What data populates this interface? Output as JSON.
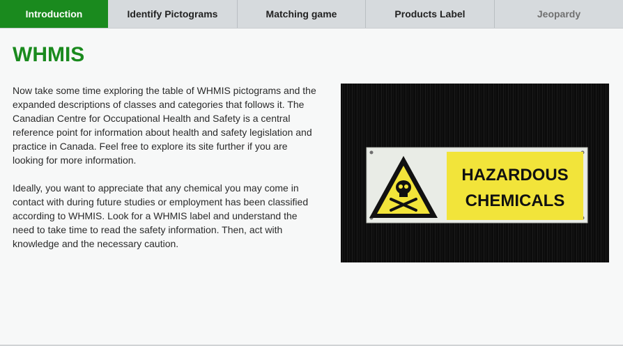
{
  "tabs": [
    {
      "label": "Introduction",
      "active": true
    },
    {
      "label": "Identify Pictograms"
    },
    {
      "label": "Matching game"
    },
    {
      "label": "Products Label"
    },
    {
      "label": "Jeopardy"
    }
  ],
  "page": {
    "title": "WHMIS",
    "paragraphs": [
      "Now take some time exploring the table of WHMIS pictograms and the expanded descriptions of classes and categories that follows it. The Canadian Centre for Occupational Health and Safety is a central reference point for information about health and safety legislation and practice in Canada. Feel free to explore its site further if you are looking for more information.",
      "Ideally, you want to appreciate that any chemical you may come in contact with during future studies or employment has been classified according to WHMIS. Look for a WHMIS label and understand the need to take time to read the safety information. Then, act with knowledge and the necessary caution."
    ]
  },
  "image": {
    "sign_line1": "HAZARDOUS",
    "sign_line2": "CHEMICALS"
  },
  "colors": {
    "accent": "#1a8a1e",
    "sign_yellow": "#f2e43a"
  }
}
